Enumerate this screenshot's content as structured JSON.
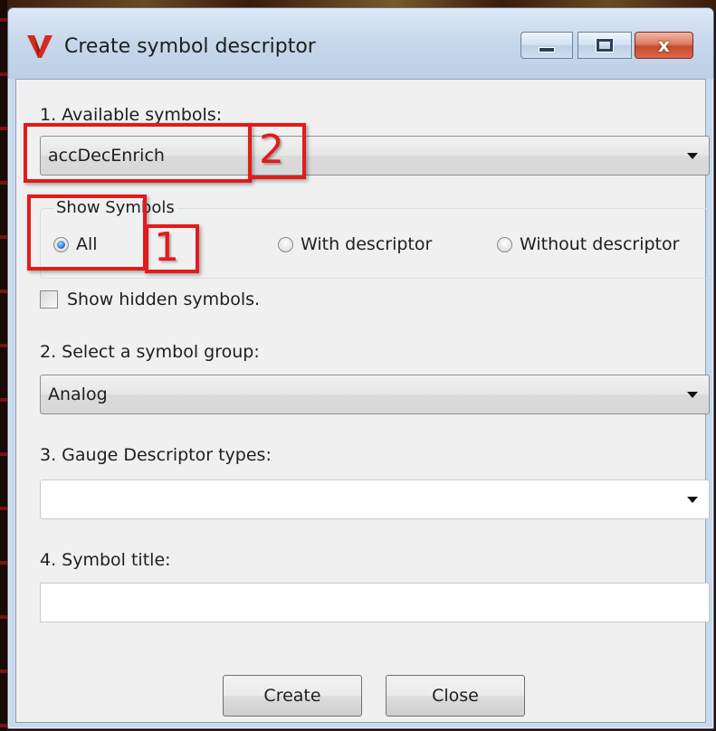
{
  "window": {
    "title": "Create symbol descriptor",
    "controls": {
      "minimize_icon": "minimize-icon",
      "maximize_icon": "maximize-icon",
      "close_glyph": "x"
    }
  },
  "app_logo": {
    "icon": "v-logo-icon",
    "color": "#d42a20"
  },
  "available_symbols": {
    "label": "1. Available symbols:",
    "selected": "accDecEnrich"
  },
  "show_symbols": {
    "group_title": "Show Symbols",
    "options": [
      {
        "label": "All",
        "checked": true
      },
      {
        "label": "With descriptor",
        "checked": false
      },
      {
        "label": "Without descriptor",
        "checked": false
      }
    ]
  },
  "show_hidden": {
    "label": "Show hidden symbols.",
    "checked": false
  },
  "symbol_group": {
    "label": "2. Select a symbol group:",
    "selected": "Analog"
  },
  "gauge_types": {
    "label": "3. Gauge Descriptor types:",
    "selected": ""
  },
  "symbol_title": {
    "label": "4. Symbol title:",
    "value": ""
  },
  "buttons": {
    "create": "Create",
    "close": "Close"
  },
  "annotations": [
    {
      "number": "1"
    },
    {
      "number": "2"
    }
  ],
  "colors": {
    "annotation": "#e21b1b",
    "titlebar": "#c6d7eb",
    "client": "#f0f0f0"
  }
}
